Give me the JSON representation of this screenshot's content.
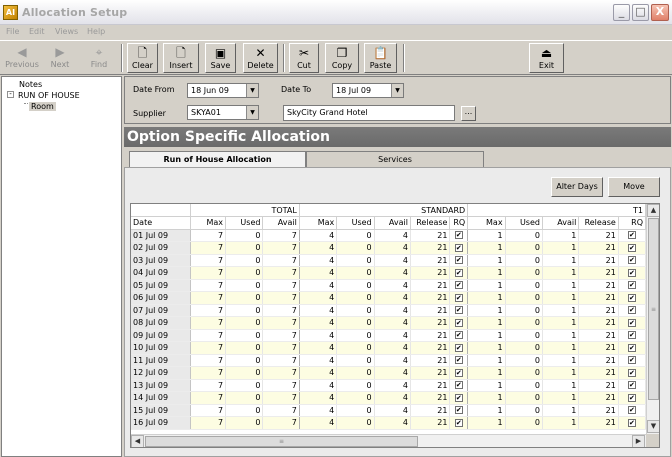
{
  "window": {
    "title": "Allocation Setup",
    "app_icon": "AI"
  },
  "window_buttons": {
    "minimize": "_",
    "maximize": "□",
    "close": "X"
  },
  "menu": [
    "File",
    "Edit",
    "Views",
    "Help"
  ],
  "toolbar": {
    "previous": "Previous",
    "next": "Next",
    "find": "Find",
    "clear": "Clear",
    "insert": "Insert",
    "save": "Save",
    "delete": "Delete",
    "cut": "Cut",
    "copy": "Copy",
    "paste": "Paste",
    "exit": "Exit"
  },
  "tree": {
    "notes": "Notes",
    "root": "RUN OF HOUSE",
    "child": "Room"
  },
  "filter": {
    "date_from_label": "Date From",
    "date_from": "18 Jun 09",
    "date_to_label": "Date To",
    "date_to": "18 Jul 09",
    "supplier_label": "Supplier",
    "supplier": "SKYA01",
    "hotel_name": "SkyCity Grand Hotel",
    "ellipsis": "..."
  },
  "section_header": "Option Specific Allocation",
  "tabs": [
    "Run of House Allocation",
    "Services"
  ],
  "buttons": {
    "alter_days": "Alter Days",
    "move": "Move"
  },
  "grid": {
    "groups": [
      "TOTAL",
      "STANDARD",
      "T1"
    ],
    "columns": [
      "Date",
      "Max",
      "Used",
      "Avail",
      "Max",
      "Used",
      "Avail",
      "Release",
      "RQ",
      "Max",
      "Used",
      "Avail",
      "Release",
      "RQ"
    ],
    "rows": [
      [
        "01 Jul 09",
        "7",
        "0",
        "7",
        "4",
        "0",
        "4",
        "21",
        "✔",
        "1",
        "0",
        "1",
        "21",
        "✔"
      ],
      [
        "02 Jul 09",
        "7",
        "0",
        "7",
        "4",
        "0",
        "4",
        "21",
        "✔",
        "1",
        "0",
        "1",
        "21",
        "✔"
      ],
      [
        "03 Jul 09",
        "7",
        "0",
        "7",
        "4",
        "0",
        "4",
        "21",
        "✔",
        "1",
        "0",
        "1",
        "21",
        "✔"
      ],
      [
        "04 Jul 09",
        "7",
        "0",
        "7",
        "4",
        "0",
        "4",
        "21",
        "✔",
        "1",
        "0",
        "1",
        "21",
        "✔"
      ],
      [
        "05 Jul 09",
        "7",
        "0",
        "7",
        "4",
        "0",
        "4",
        "21",
        "✔",
        "1",
        "0",
        "1",
        "21",
        "✔"
      ],
      [
        "06 Jul 09",
        "7",
        "0",
        "7",
        "4",
        "0",
        "4",
        "21",
        "✔",
        "1",
        "0",
        "1",
        "21",
        "✔"
      ],
      [
        "07 Jul 09",
        "7",
        "0",
        "7",
        "4",
        "0",
        "4",
        "21",
        "✔",
        "1",
        "0",
        "1",
        "21",
        "✔"
      ],
      [
        "08 Jul 09",
        "7",
        "0",
        "7",
        "4",
        "0",
        "4",
        "21",
        "✔",
        "1",
        "0",
        "1",
        "21",
        "✔"
      ],
      [
        "09 Jul 09",
        "7",
        "0",
        "7",
        "4",
        "0",
        "4",
        "21",
        "✔",
        "1",
        "0",
        "1",
        "21",
        "✔"
      ],
      [
        "10 Jul 09",
        "7",
        "0",
        "7",
        "4",
        "0",
        "4",
        "21",
        "✔",
        "1",
        "0",
        "1",
        "21",
        "✔"
      ],
      [
        "11 Jul 09",
        "7",
        "0",
        "7",
        "4",
        "0",
        "4",
        "21",
        "✔",
        "1",
        "0",
        "1",
        "21",
        "✔"
      ],
      [
        "12 Jul 09",
        "7",
        "0",
        "7",
        "4",
        "0",
        "4",
        "21",
        "✔",
        "1",
        "0",
        "1",
        "21",
        "✔"
      ],
      [
        "13 Jul 09",
        "7",
        "0",
        "7",
        "4",
        "0",
        "4",
        "21",
        "✔",
        "1",
        "0",
        "1",
        "21",
        "✔"
      ],
      [
        "14 Jul 09",
        "7",
        "0",
        "7",
        "4",
        "0",
        "4",
        "21",
        "✔",
        "1",
        "0",
        "1",
        "21",
        "✔"
      ],
      [
        "15 Jul 09",
        "7",
        "0",
        "7",
        "4",
        "0",
        "4",
        "21",
        "✔",
        "1",
        "0",
        "1",
        "21",
        "✔"
      ],
      [
        "16 Jul 09",
        "7",
        "0",
        "7",
        "4",
        "0",
        "4",
        "21",
        "✔",
        "1",
        "0",
        "1",
        "21",
        "✔"
      ]
    ]
  },
  "icons": {
    "previous": "previous-icon",
    "next": "next-icon",
    "find": "binoculars-icon",
    "clear": "blank-page-icon",
    "insert": "insert-page-icon",
    "save": "floppy-disk-icon",
    "delete": "x-icon",
    "cut": "scissors-icon",
    "copy": "copy-icon",
    "paste": "clipboard-icon",
    "exit": "exit-door-icon"
  },
  "glyphs": {
    "previous": "◀",
    "next": "▶",
    "find": "⌖",
    "clear": "🗋",
    "insert": "🗋",
    "save": "▣",
    "delete": "✕",
    "cut": "✂",
    "copy": "❐",
    "paste": "📋",
    "exit": "⏏",
    "dropdown": "▼",
    "scroll_up": "▲",
    "scroll_down": "▼",
    "scroll_left": "◀",
    "scroll_right": "▶",
    "grip": "≡"
  },
  "colors": {
    "header_bar": "#6f6f6f",
    "alt_row": "#fdfde2",
    "window_bg": "#d4d0c8"
  }
}
